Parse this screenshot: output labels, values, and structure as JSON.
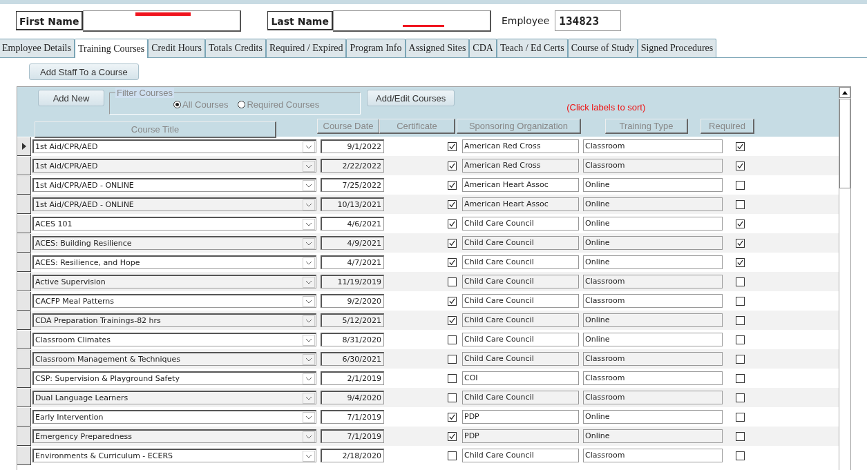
{
  "header": {
    "first_name_label": "First Name",
    "last_name_label": "Last Name",
    "employee_label": "Employee",
    "employee_id": "134823"
  },
  "tabs": [
    {
      "label": "Employee Details",
      "selected": false
    },
    {
      "label": "Training Courses",
      "selected": true
    },
    {
      "label": "Credit Hours",
      "selected": false
    },
    {
      "label": "Totals Credits",
      "selected": false
    },
    {
      "label": "Required / Expired",
      "selected": false
    },
    {
      "label": "Program Info",
      "selected": false
    },
    {
      "label": "Assigned Sites",
      "selected": false
    },
    {
      "label": "CDA",
      "selected": false
    },
    {
      "label": "Teach / Ed Certs",
      "selected": false
    },
    {
      "label": "Course of Study",
      "selected": false
    },
    {
      "label": "Signed Procedures",
      "selected": false
    }
  ],
  "add_staff_button": "Add Staff To a Course",
  "toolbar": {
    "add_new_button": "Add New",
    "filter": {
      "legend": "Filter Courses",
      "options": [
        {
          "label": "All Courses",
          "selected": true
        },
        {
          "label": "Required Courses",
          "selected": false
        }
      ]
    },
    "add_edit_button": "Add/Edit Courses",
    "sort_hint": "(Click labels to sort)"
  },
  "columns": [
    "Course Title",
    "Course Date",
    "Certificate",
    "Sponsoring Organization",
    "Training Type",
    "Required"
  ],
  "rows": [
    {
      "title": "1st Aid/CPR/AED",
      "date": "9/1/2022",
      "certificate": true,
      "sponsor": "American Red Cross",
      "type": "Classroom",
      "required": true,
      "selected": true
    },
    {
      "title": "1st Aid/CPR/AED",
      "date": "2/22/2022",
      "certificate": true,
      "sponsor": "American Red Cross",
      "type": "Classroom",
      "required": true,
      "selected": false
    },
    {
      "title": "1st Aid/CPR/AED - ONLINE",
      "date": "7/25/2022",
      "certificate": true,
      "sponsor": "American Heart Assoc",
      "type": "Online",
      "required": false,
      "selected": false
    },
    {
      "title": "1st Aid/CPR/AED - ONLINE",
      "date": "10/13/2021",
      "certificate": true,
      "sponsor": "American Heart Assoc",
      "type": "Online",
      "required": false,
      "selected": false
    },
    {
      "title": "ACES 101",
      "date": "4/6/2021",
      "certificate": true,
      "sponsor": "Child Care Council",
      "type": "Online",
      "required": true,
      "selected": false
    },
    {
      "title": "ACES: Building Resilience",
      "date": "4/9/2021",
      "certificate": true,
      "sponsor": "Child Care Council",
      "type": "Online",
      "required": true,
      "selected": false
    },
    {
      "title": "ACES: Resilience, and Hope",
      "date": "4/7/2021",
      "certificate": true,
      "sponsor": "Child Care Council",
      "type": "Online",
      "required": true,
      "selected": false
    },
    {
      "title": "Active Supervision",
      "date": "11/19/2019",
      "certificate": false,
      "sponsor": "Child Care Council",
      "type": "Classroom",
      "required": false,
      "selected": false
    },
    {
      "title": "CACFP Meal Patterns",
      "date": "9/2/2020",
      "certificate": true,
      "sponsor": "Child Care Council",
      "type": "Classroom",
      "required": false,
      "selected": false
    },
    {
      "title": "CDA Preparation Trainings-82 hrs",
      "date": "5/12/2021",
      "certificate": true,
      "sponsor": "Child Care Council",
      "type": "Online",
      "required": false,
      "selected": false
    },
    {
      "title": "Classroom Climates",
      "date": "8/31/2020",
      "certificate": false,
      "sponsor": "Child Care Council",
      "type": "Online",
      "required": false,
      "selected": false
    },
    {
      "title": "Classroom Management & Techniques",
      "date": "6/30/2021",
      "certificate": false,
      "sponsor": "Child Care Council",
      "type": "Classroom",
      "required": false,
      "selected": false
    },
    {
      "title": "CSP: Supervision & Playground Safety",
      "date": "2/1/2019",
      "certificate": false,
      "sponsor": "COI",
      "type": "Classroom",
      "required": false,
      "selected": false
    },
    {
      "title": "Dual Language Learners",
      "date": "9/4/2020",
      "certificate": false,
      "sponsor": "Child Care Council",
      "type": "Classroom",
      "required": false,
      "selected": false
    },
    {
      "title": "Early Intervention",
      "date": "7/1/2019",
      "certificate": true,
      "sponsor": "PDP",
      "type": "Online",
      "required": false,
      "selected": false
    },
    {
      "title": "Emergency Preparedness",
      "date": "7/1/2019",
      "certificate": true,
      "sponsor": "PDP",
      "type": "Online",
      "required": false,
      "selected": false
    },
    {
      "title": "Environments & Curriculum - ECERS",
      "date": "2/18/2020",
      "certificate": false,
      "sponsor": "Child Care Council",
      "type": "Classroom",
      "required": false,
      "selected": false
    }
  ]
}
